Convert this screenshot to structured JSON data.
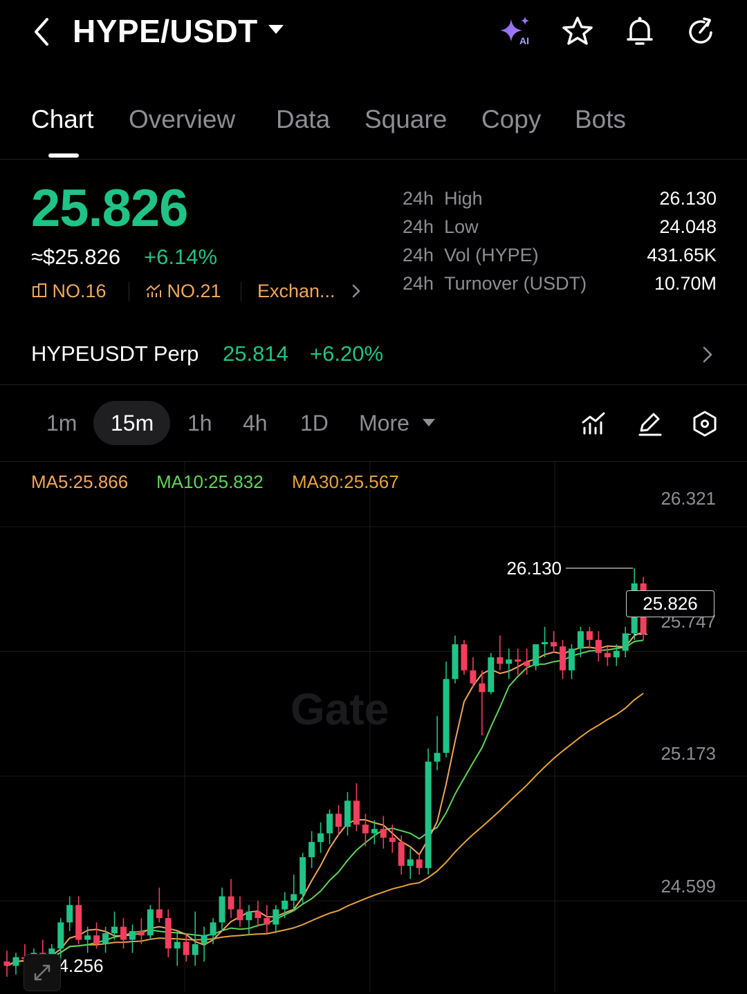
{
  "header": {
    "pair": "HYPE/USDT",
    "icons": [
      "back-icon",
      "ai-sparkle-icon",
      "star-icon",
      "bell-icon",
      "refresh-icon"
    ],
    "ai_badge": "AI"
  },
  "tabs": [
    {
      "label": "Chart",
      "active": true
    },
    {
      "label": "Overview"
    },
    {
      "label": "Data"
    },
    {
      "label": "Square"
    },
    {
      "label": "Copy"
    },
    {
      "label": "Bots"
    }
  ],
  "ticker": {
    "last_price": "25.826",
    "usd_price": "≈$25.826",
    "change": "+6.14%",
    "rank_market_cap": "NO.16",
    "rank_trend": "NO.21",
    "exchange_link": "Exchan...",
    "stats": [
      {
        "period": "24h",
        "label": "High",
        "value": "26.130"
      },
      {
        "period": "24h",
        "label": "Low",
        "value": "24.048"
      },
      {
        "period": "24h",
        "label": "Vol (HYPE)",
        "value": "431.65K"
      },
      {
        "period": "24h",
        "label": "Turnover (USDT)",
        "value": "10.70M"
      }
    ]
  },
  "perp": {
    "name": "HYPEUSDT Perp",
    "price": "25.814",
    "change": "+6.20%"
  },
  "intervals": {
    "items": [
      "1m",
      "15m",
      "1h",
      "4h",
      "1D"
    ],
    "active": "15m",
    "more_label": "More"
  },
  "chart_data": {
    "type": "candlestick",
    "indicators": {
      "ma5": "MA5:25.866",
      "ma10": "MA10:25.832",
      "ma30": "MA30:25.567"
    },
    "y_ticks": [
      "26.321",
      "25.747",
      "25.173",
      "24.599"
    ],
    "ylim": [
      24.18,
      26.62
    ],
    "high_label": "26.130",
    "low_label": "24.256",
    "last_price_label": "25.826",
    "watermark": "Gate",
    "colors": {
      "up": "#20c386",
      "down": "#f23f5d",
      "ma5": "#f0a75c",
      "ma10": "#5ed65a",
      "ma30": "#e8a33c"
    },
    "candles": [
      {
        "o": 24.32,
        "h": 24.37,
        "l": 24.25,
        "c": 24.3
      },
      {
        "o": 24.3,
        "h": 24.36,
        "l": 24.26,
        "c": 24.34
      },
      {
        "o": 24.34,
        "h": 24.4,
        "l": 24.3,
        "c": 24.33
      },
      {
        "o": 24.33,
        "h": 24.38,
        "l": 24.28,
        "c": 24.36
      },
      {
        "o": 24.36,
        "h": 24.42,
        "l": 24.3,
        "c": 24.32
      },
      {
        "o": 24.32,
        "h": 24.4,
        "l": 24.28,
        "c": 24.38
      },
      {
        "o": 24.38,
        "h": 24.52,
        "l": 24.33,
        "c": 24.5
      },
      {
        "o": 24.5,
        "h": 24.62,
        "l": 24.46,
        "c": 24.58
      },
      {
        "o": 24.58,
        "h": 24.62,
        "l": 24.4,
        "c": 24.42
      },
      {
        "o": 24.42,
        "h": 24.48,
        "l": 24.36,
        "c": 24.44
      },
      {
        "o": 24.44,
        "h": 24.5,
        "l": 24.38,
        "c": 24.4
      },
      {
        "o": 24.4,
        "h": 24.48,
        "l": 24.36,
        "c": 24.45
      },
      {
        "o": 24.45,
        "h": 24.55,
        "l": 24.42,
        "c": 24.48
      },
      {
        "o": 24.48,
        "h": 24.52,
        "l": 24.38,
        "c": 24.42
      },
      {
        "o": 24.42,
        "h": 24.49,
        "l": 24.36,
        "c": 24.46
      },
      {
        "o": 24.46,
        "h": 24.52,
        "l": 24.4,
        "c": 24.44
      },
      {
        "o": 24.44,
        "h": 24.58,
        "l": 24.42,
        "c": 24.56
      },
      {
        "o": 24.56,
        "h": 24.66,
        "l": 24.5,
        "c": 24.52
      },
      {
        "o": 24.52,
        "h": 24.56,
        "l": 24.34,
        "c": 24.38
      },
      {
        "o": 24.38,
        "h": 24.46,
        "l": 24.3,
        "c": 24.41
      },
      {
        "o": 24.41,
        "h": 24.45,
        "l": 24.32,
        "c": 24.35
      },
      {
        "o": 24.35,
        "h": 24.55,
        "l": 24.3,
        "c": 24.4
      },
      {
        "o": 24.4,
        "h": 24.48,
        "l": 24.32,
        "c": 24.44
      },
      {
        "o": 24.44,
        "h": 24.52,
        "l": 24.4,
        "c": 24.5
      },
      {
        "o": 24.5,
        "h": 24.66,
        "l": 24.46,
        "c": 24.62
      },
      {
        "o": 24.62,
        "h": 24.7,
        "l": 24.52,
        "c": 24.56
      },
      {
        "o": 24.56,
        "h": 24.62,
        "l": 24.48,
        "c": 24.51
      },
      {
        "o": 24.51,
        "h": 24.58,
        "l": 24.44,
        "c": 24.55
      },
      {
        "o": 24.55,
        "h": 24.6,
        "l": 24.48,
        "c": 24.52
      },
      {
        "o": 24.52,
        "h": 24.58,
        "l": 24.45,
        "c": 24.49
      },
      {
        "o": 24.49,
        "h": 24.58,
        "l": 24.45,
        "c": 24.56
      },
      {
        "o": 24.56,
        "h": 24.64,
        "l": 24.52,
        "c": 24.6
      },
      {
        "o": 24.6,
        "h": 24.72,
        "l": 24.55,
        "c": 24.63
      },
      {
        "o": 24.63,
        "h": 24.82,
        "l": 24.58,
        "c": 24.8
      },
      {
        "o": 24.8,
        "h": 24.92,
        "l": 24.75,
        "c": 24.87
      },
      {
        "o": 24.87,
        "h": 24.96,
        "l": 24.82,
        "c": 24.91
      },
      {
        "o": 24.91,
        "h": 25.02,
        "l": 24.86,
        "c": 25.0
      },
      {
        "o": 25.0,
        "h": 25.04,
        "l": 24.9,
        "c": 24.94
      },
      {
        "o": 24.94,
        "h": 25.1,
        "l": 24.9,
        "c": 25.06
      },
      {
        "o": 25.06,
        "h": 25.14,
        "l": 24.92,
        "c": 24.95
      },
      {
        "o": 24.95,
        "h": 25.0,
        "l": 24.85,
        "c": 24.91
      },
      {
        "o": 24.91,
        "h": 24.97,
        "l": 24.86,
        "c": 24.93
      },
      {
        "o": 24.93,
        "h": 24.99,
        "l": 24.84,
        "c": 24.89
      },
      {
        "o": 24.89,
        "h": 24.95,
        "l": 24.82,
        "c": 24.87
      },
      {
        "o": 24.87,
        "h": 24.9,
        "l": 24.72,
        "c": 24.76
      },
      {
        "o": 24.76,
        "h": 24.84,
        "l": 24.7,
        "c": 24.79
      },
      {
        "o": 24.79,
        "h": 24.82,
        "l": 24.72,
        "c": 24.75
      },
      {
        "o": 24.75,
        "h": 25.3,
        "l": 24.72,
        "c": 25.24
      },
      {
        "o": 25.24,
        "h": 25.45,
        "l": 25.2,
        "c": 25.28
      },
      {
        "o": 25.28,
        "h": 25.7,
        "l": 25.26,
        "c": 25.62
      },
      {
        "o": 25.62,
        "h": 25.82,
        "l": 25.6,
        "c": 25.78
      },
      {
        "o": 25.78,
        "h": 25.8,
        "l": 25.64,
        "c": 25.66
      },
      {
        "o": 25.66,
        "h": 25.72,
        "l": 25.58,
        "c": 25.6
      },
      {
        "o": 25.6,
        "h": 25.66,
        "l": 25.36,
        "c": 25.56
      },
      {
        "o": 25.56,
        "h": 25.74,
        "l": 25.55,
        "c": 25.72
      },
      {
        "o": 25.72,
        "h": 25.82,
        "l": 25.66,
        "c": 25.69
      },
      {
        "o": 25.69,
        "h": 25.76,
        "l": 25.62,
        "c": 25.71
      },
      {
        "o": 25.71,
        "h": 25.76,
        "l": 25.64,
        "c": 25.7
      },
      {
        "o": 25.7,
        "h": 25.76,
        "l": 25.64,
        "c": 25.68
      },
      {
        "o": 25.68,
        "h": 25.78,
        "l": 25.66,
        "c": 25.78
      },
      {
        "o": 25.78,
        "h": 25.86,
        "l": 25.72,
        "c": 25.79
      },
      {
        "o": 25.79,
        "h": 25.84,
        "l": 25.74,
        "c": 25.77
      },
      {
        "o": 25.77,
        "h": 25.8,
        "l": 25.62,
        "c": 25.66
      },
      {
        "o": 25.66,
        "h": 25.78,
        "l": 25.62,
        "c": 25.76
      },
      {
        "o": 25.76,
        "h": 25.86,
        "l": 25.72,
        "c": 25.84
      },
      {
        "o": 25.84,
        "h": 25.86,
        "l": 25.76,
        "c": 25.8
      },
      {
        "o": 25.8,
        "h": 25.84,
        "l": 25.7,
        "c": 25.74
      },
      {
        "o": 25.74,
        "h": 25.77,
        "l": 25.68,
        "c": 25.72
      },
      {
        "o": 25.72,
        "h": 25.78,
        "l": 25.68,
        "c": 25.75
      },
      {
        "o": 25.75,
        "h": 25.86,
        "l": 25.72,
        "c": 25.83
      },
      {
        "o": 25.83,
        "h": 26.13,
        "l": 25.8,
        "c": 26.06
      },
      {
        "o": 26.06,
        "h": 26.09,
        "l": 25.8,
        "c": 25.826
      }
    ]
  }
}
